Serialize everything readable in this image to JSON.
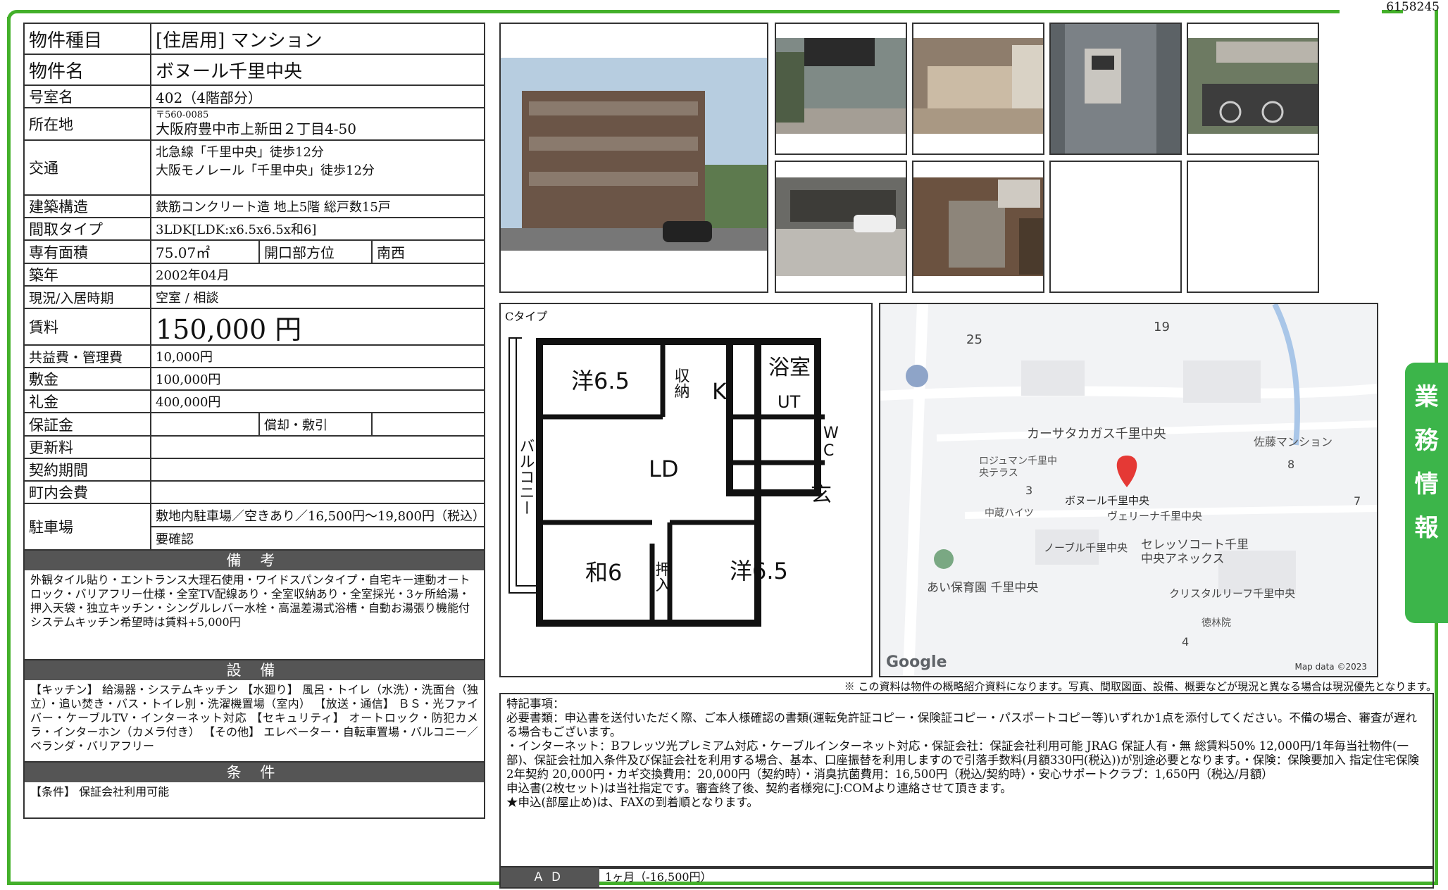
{
  "doc_id": "6158245",
  "side_tab": "業務情報",
  "spec": {
    "property_type_label": "物件種目",
    "property_type": "[住居用] マンション",
    "name_label": "物件名",
    "name": "ボヌール千里中央",
    "room_label": "号室名",
    "room": "402（4階部分）",
    "address_label": "所在地",
    "postal": "〒560-0085",
    "address": "大阪府豊中市上新田２丁目4-50",
    "transport_label": "交通",
    "transport_1": "北急線「千里中央」徒歩12分",
    "transport_2": "大阪モノレール「千里中央」徒歩12分",
    "structure_label": "建築構造",
    "structure": "鉄筋コンクリート造 地上5階 総戸数15戸",
    "layout_label": "間取タイプ",
    "layout": "3LDK[LDK:x6.5x6.5x和6]",
    "area_label": "専有面積",
    "area": "75.07㎡",
    "facing_label": "開口部方位",
    "facing": "南西",
    "built_label": "築年",
    "built": "2002年04月",
    "status_label": "現況/入居時期",
    "status": "空室 / 相談",
    "rent_label": "賃料",
    "rent": "150,000 円",
    "fee_label": "共益費・管理費",
    "fee": "10,000円",
    "deposit_label": "敷金",
    "deposit": "100,000円",
    "key_money_label": "礼金",
    "key_money": "400,000円",
    "guarantee_label": "保証金",
    "amortization_label": "償却・敷引",
    "renewal_label": "更新料",
    "contract_label": "契約期間",
    "community_label": "町内会費",
    "parking_label": "駐車場",
    "parking_1": "敷地内駐車場／空きあり／16,500円～19,800円（税込）",
    "parking_2": "要確認"
  },
  "remarks": {
    "title": "備 考",
    "text_1": "外観タイル貼り・エントランス大理石使用・ワイドスパンタイプ・自宅キー連動オートロック・バリアフリー仕様・全室TV配線あり・全室収納あり・全室採光・3ヶ所給湯・押入天袋・独立キッチン・シングルレバー水栓・高温差湯式浴槽・自動お湯張り機能付",
    "text_2": "システムキッチン希望時は賃料+5,000円"
  },
  "equipment": {
    "title": "設 備",
    "text": "【キッチン】 給湯器・システムキッチン 【水廻り】 風呂・トイレ（水洗）・洗面台（独立）・追い焚き・バス・トイレ別・洗濯機置場（室内） 【放送・通信】 ＢＳ・光ファイバー・ケーブルTV・インターネット対応 【セキュリティ】 オートロック・防犯カメラ・インターホン（カメラ付き） 【その他】 エレベーター・自転車置場・バルコニー／ベランダ・バリアフリー"
  },
  "conditions": {
    "title": "条 件",
    "text": "【条件】 保証会社利用可能"
  },
  "floorplan": {
    "type_label": "Cタイプ",
    "rooms": [
      "洋6.5",
      "収納",
      "K",
      "浴室",
      "UT",
      "W",
      "C",
      "LD",
      "バルコニー",
      "玄",
      "和6",
      "押入",
      "洋6.5"
    ]
  },
  "map": {
    "places": [
      "25",
      "19",
      "カーサタカガス千里中央",
      "佐藤マンション",
      "ロジュマン千里中央テラス",
      "8",
      "3",
      "ボヌール千里中央",
      "中蔵ハイツ",
      "ヴェリーナ千里中央",
      "7",
      "ノーブル千里中央",
      "セレッソコート千里中央アネックス",
      "あい保育園 千里中央",
      "クリスタルリーフ千里中央",
      "徳林院",
      "4"
    ],
    "logo": "Google",
    "attribution": "Map data ©2023"
  },
  "notice": "※ この資料は物件の概略紹介資料になります。写真、間取図面、設備、概要などが現況と異なる場合は現況優先となります。",
  "notes": {
    "title": "特記事項：",
    "lines": [
      "必要書類：申込書を送付いただく際、ご本人様確認の書類(運転免許証コピー・保険証コピー・パスポートコピー等)いずれか1点を添付してください。不備の場合、審査が遅れる場合もございます。",
      "・インターネット：Bフレッツ光プレミアム対応・ケーブルインターネット対応・保証会社：保証会社利用可能 JRAG 保証人有・無 総賃料50% 12,000円/1年毎当社物件(一部)、保証会社加入条件及び保証会社を利用する場合、基本、口座振替を利用しますので引落手数料(月額330円(税込))が別途必要となります。・保険：保険要加入 指定住宅保険 2年契約 20,000円・カギ交換費用：20,000円（契約時）・消臭抗菌費用：16,500円（税込/契約時）・安心サポートクラブ：1,650円（税込/月額）",
      "申込書(2枚セット)は当社指定です。審査終了後、契約者様宛にJ:COMより連絡させて頂きます。",
      "★申込(部屋止め)は、FAXの到着順となります。"
    ]
  },
  "ad": {
    "label": "ＡＤ",
    "value": "1ヶ月（-16,500円）"
  }
}
